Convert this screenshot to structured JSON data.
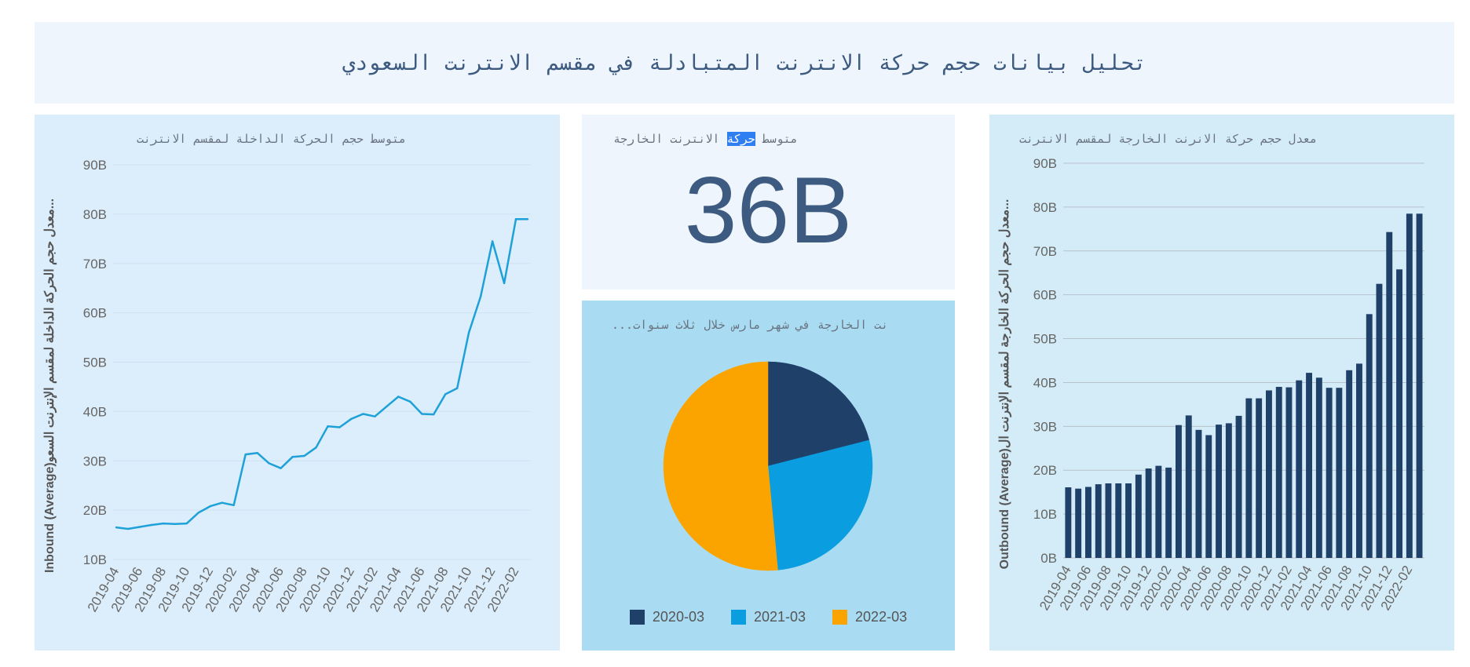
{
  "header": {
    "title": "تحليل بيانات حجم حركة الانترنت المتبادلة في مقسم الانترنت السعودي"
  },
  "kpi": {
    "title_before": "متوسط ",
    "title_highlight": "حركة",
    "title_after": " الانترنت الخارجة",
    "value": "36B"
  },
  "chart_data": [
    {
      "type": "line",
      "title": "متوسط حجم الحركة الداخلة لمقسم الانترنت",
      "xlabel": "",
      "ylabel": "Inbound (Average)معدل حجم الحركة الداخلة لمقسم الإنترنت السعو...",
      "x": [
        "2019-04",
        "2019-05",
        "2019-06",
        "2019-07",
        "2019-08",
        "2019-09",
        "2019-10",
        "2019-11",
        "2019-12",
        "2020-01",
        "2020-02",
        "2020-03",
        "2020-04",
        "2020-05",
        "2020-06",
        "2020-07",
        "2020-08",
        "2020-09",
        "2020-10",
        "2020-11",
        "2020-12",
        "2021-01",
        "2021-02",
        "2021-03",
        "2021-04",
        "2021-05",
        "2021-06",
        "2021-07",
        "2021-08",
        "2021-09",
        "2021-10",
        "2021-11",
        "2021-12",
        "2022-01",
        "2022-02",
        "2022-03"
      ],
      "x_tick_labels": [
        "2019-04",
        "2019-06",
        "2019-08",
        "2019-10",
        "2019-12",
        "2020-02",
        "2020-04",
        "2020-06",
        "2020-08",
        "2020-10",
        "2020-12",
        "2021-02",
        "2021-04",
        "2021-06",
        "2021-08",
        "2021-10",
        "2021-12",
        "2022-02"
      ],
      "y_tick_labels": [
        "10B",
        "20B",
        "30B",
        "40B",
        "50B",
        "60B",
        "70B",
        "80B",
        "90B"
      ],
      "ylim": [
        10,
        90
      ],
      "unit": "B",
      "grid": true,
      "color": "#1ea1d8",
      "values": [
        16.5,
        16.2,
        16.6,
        17.0,
        17.3,
        17.2,
        17.3,
        19.5,
        20.8,
        21.5,
        21.0,
        31.3,
        31.6,
        29.5,
        28.5,
        30.8,
        31.0,
        32.7,
        37.0,
        36.8,
        38.5,
        39.5,
        39.0,
        41.0,
        43.0,
        42.0,
        39.5,
        39.4,
        43.5,
        44.7,
        56.0,
        63.3,
        74.5,
        66.0,
        79.0,
        79.0
      ]
    },
    {
      "type": "pie",
      "title": "...نت الخارجة في شهر مارس خلال ثلاث سنوات",
      "labels": [
        "2020-03",
        "2021-03",
        "2022-03"
      ],
      "values": [
        21,
        27.5,
        51.5
      ],
      "colors": [
        "#1f4068",
        "#0a9ee0",
        "#fba400"
      ],
      "legend": "bottom"
    },
    {
      "type": "bar",
      "title": "معدل حجم حركة الانرنت الخارجة لمقسم الانترنت",
      "xlabel": "",
      "ylabel": "Outbound (Average)معدل حجم الحركة الخارجة لمقسم الإنترنت ال...",
      "x": [
        "2019-04",
        "2019-05",
        "2019-06",
        "2019-07",
        "2019-08",
        "2019-09",
        "2019-10",
        "2019-11",
        "2019-12",
        "2020-01",
        "2020-02",
        "2020-03",
        "2020-04",
        "2020-05",
        "2020-06",
        "2020-07",
        "2020-08",
        "2020-09",
        "2020-10",
        "2020-11",
        "2020-12",
        "2021-01",
        "2021-02",
        "2021-03",
        "2021-04",
        "2021-05",
        "2021-06",
        "2021-07",
        "2021-08",
        "2021-09",
        "2021-10",
        "2021-11",
        "2021-12",
        "2022-01",
        "2022-02",
        "2022-03"
      ],
      "x_tick_labels": [
        "2019-04",
        "2019-06",
        "2019-08",
        "2019-10",
        "2019-12",
        "2020-02",
        "2020-04",
        "2020-06",
        "2020-08",
        "2020-10",
        "2020-12",
        "2021-02",
        "2021-04",
        "2021-06",
        "2021-08",
        "2021-10",
        "2021-12",
        "2022-02"
      ],
      "y_tick_labels": [
        "0B",
        "10B",
        "20B",
        "30B",
        "40B",
        "50B",
        "60B",
        "70B",
        "80B",
        "90B"
      ],
      "ylim": [
        0,
        90
      ],
      "unit": "B",
      "grid": true,
      "color": "#1f4068",
      "values": [
        16.1,
        15.8,
        16.2,
        16.8,
        17.0,
        17.0,
        17.0,
        19.0,
        20.4,
        21.0,
        20.6,
        30.3,
        32.5,
        29.2,
        28.0,
        30.4,
        30.7,
        32.4,
        36.4,
        36.4,
        38.2,
        39.0,
        38.9,
        40.5,
        42.2,
        41.1,
        38.8,
        38.8,
        42.8,
        44.3,
        55.6,
        62.5,
        74.3,
        65.8,
        78.5,
        78.5
      ]
    }
  ]
}
